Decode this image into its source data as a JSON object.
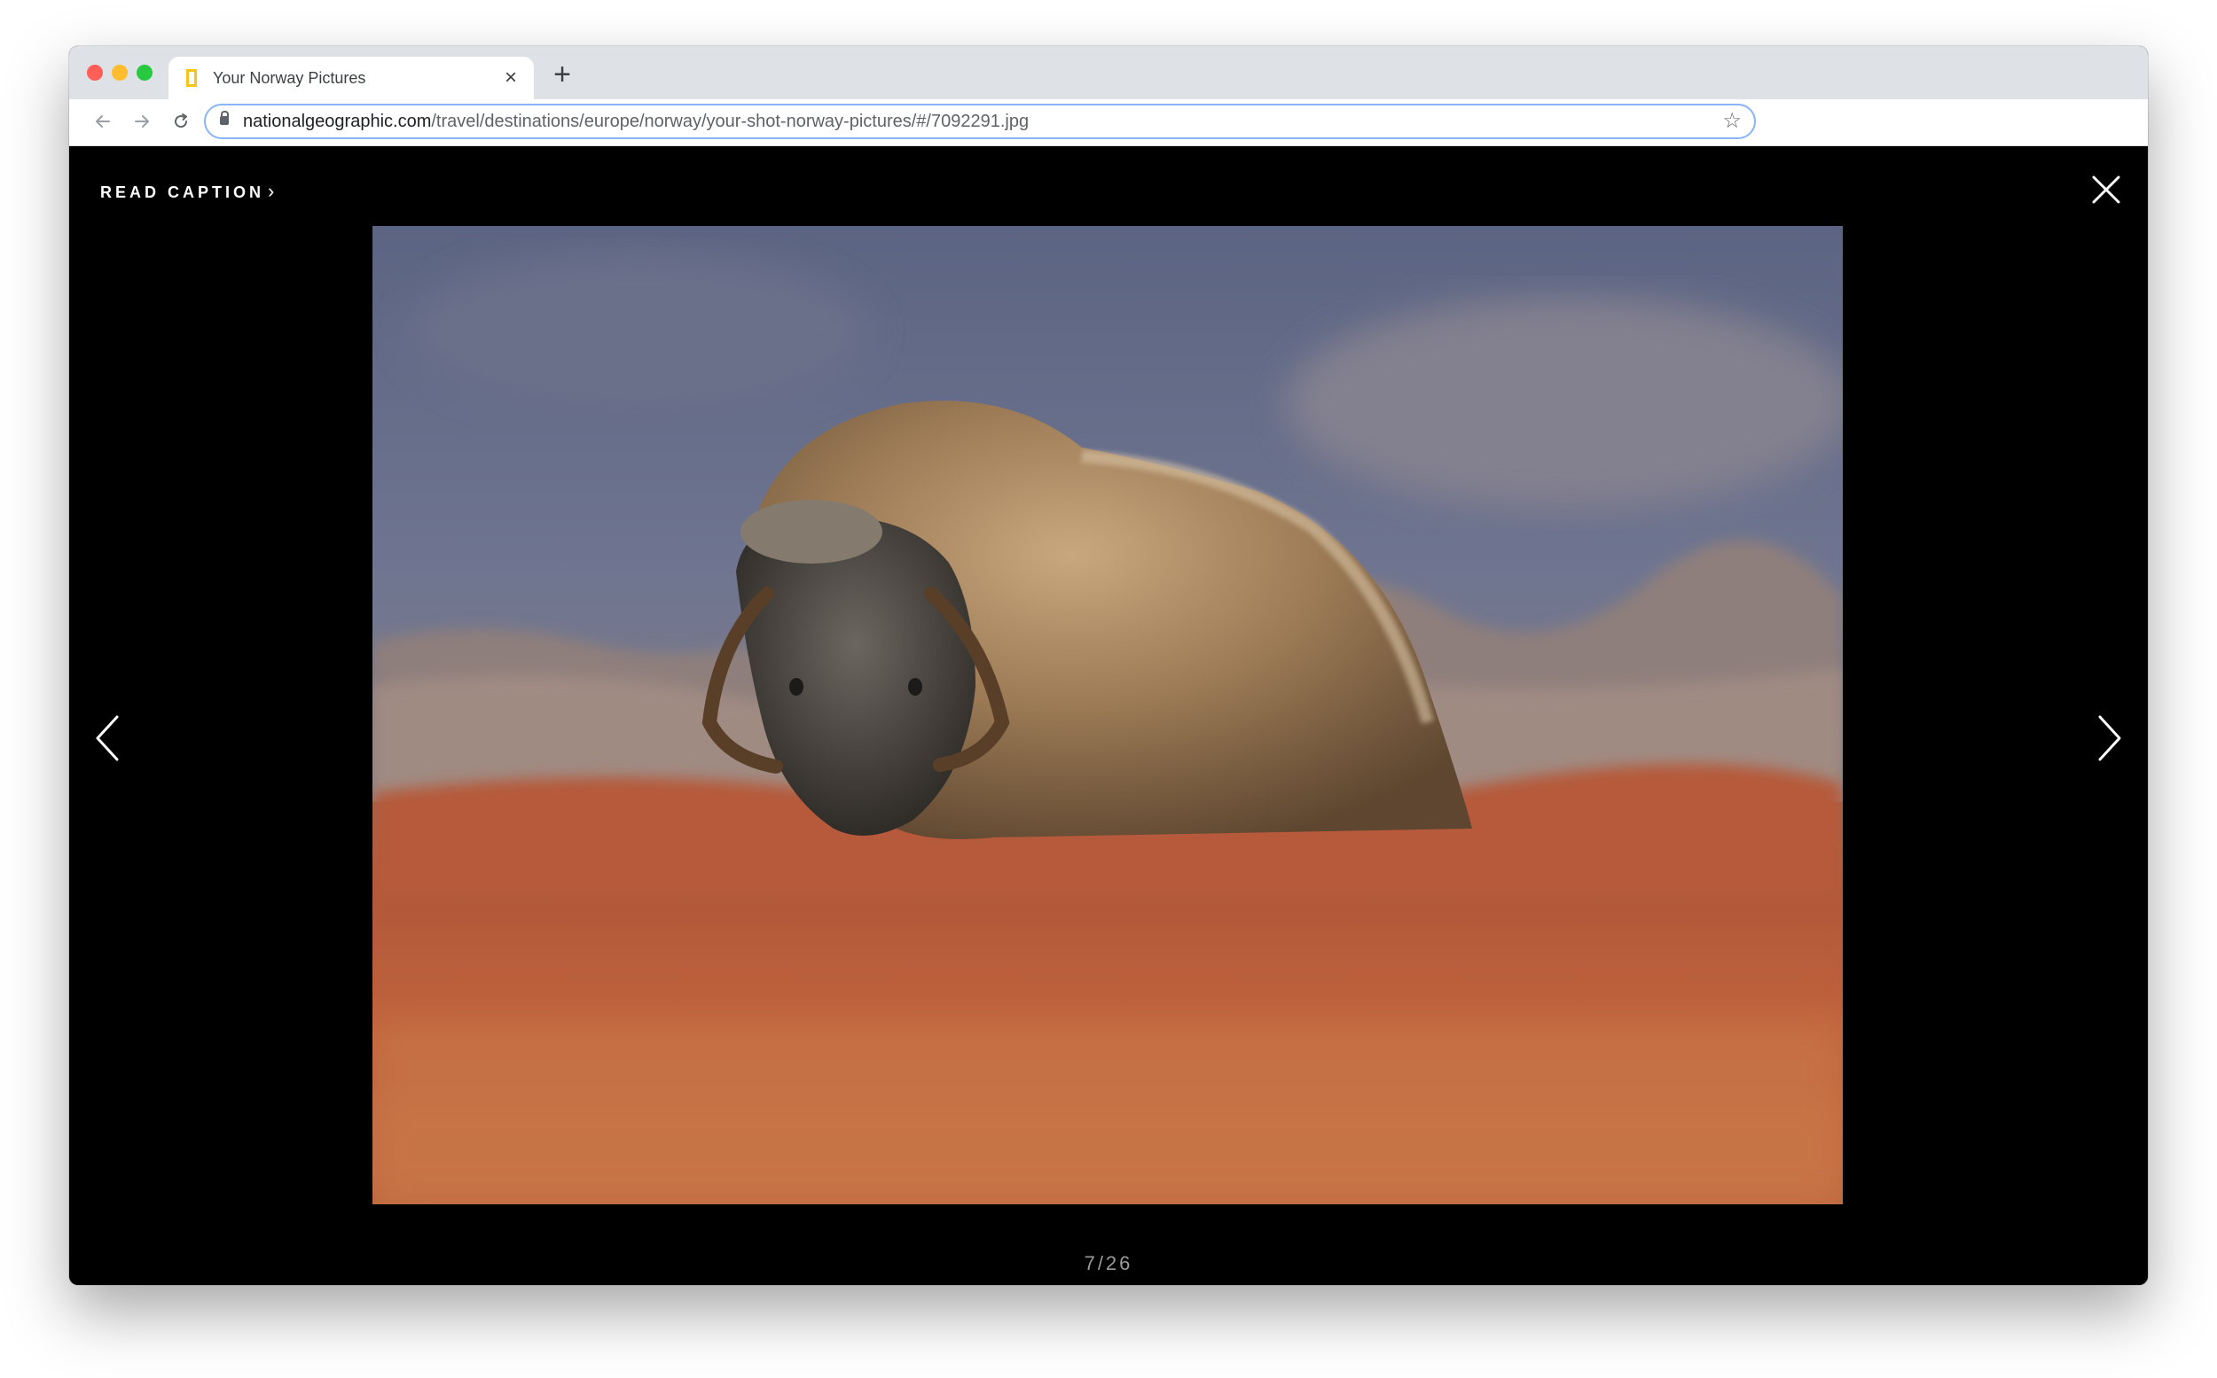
{
  "browser": {
    "tab": {
      "title": "Your Norway Pictures",
      "close_glyph": "×"
    },
    "new_tab_glyph": "+",
    "toolbar": {
      "back_icon": "arrow-left",
      "forward_icon": "arrow-right",
      "reload_icon": "reload",
      "url_host": "nationalgeographic.com",
      "url_path": "/travel/destinations/europe/norway/your-shot-norway-pictures/#/7092291.jpg",
      "bookmark_glyph": "☆"
    }
  },
  "viewer": {
    "read_caption_label": "READ CAPTION",
    "read_caption_chevron": "›",
    "counter": "7/26",
    "photo_subject": "musk ox grazing in autumn tundra"
  },
  "colors": {
    "traffic_red": "#ff5f57",
    "traffic_yellow": "#febc2e",
    "traffic_green": "#28c840",
    "favicon_yellow": "#f5c518"
  }
}
